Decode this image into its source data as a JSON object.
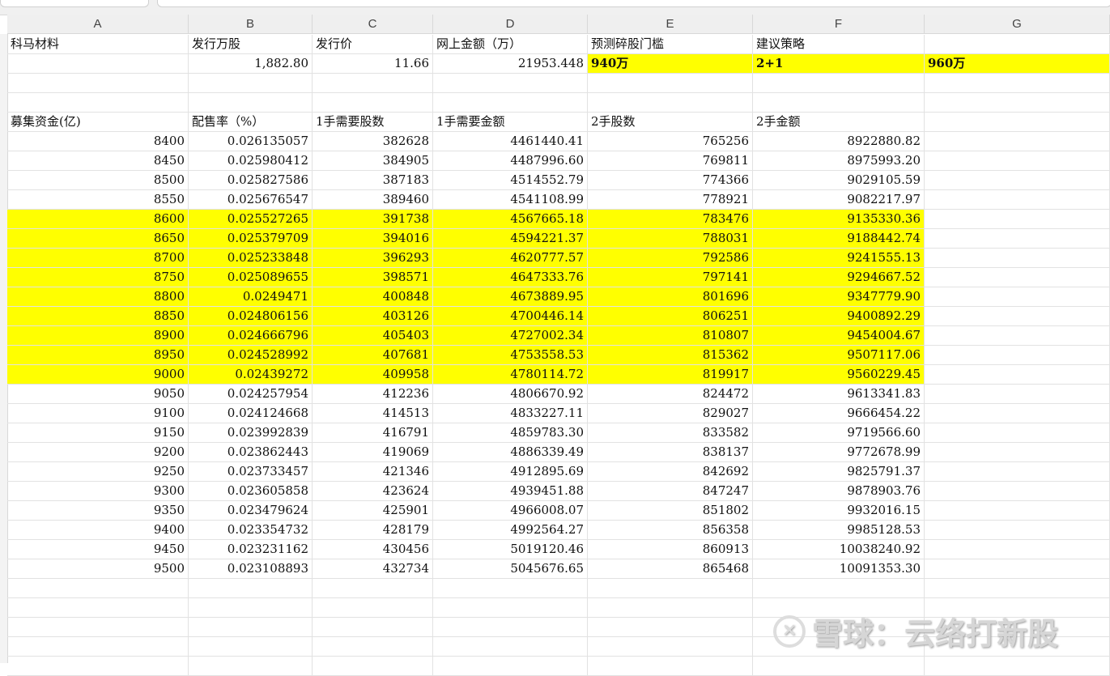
{
  "columns": [
    "A",
    "B",
    "C",
    "D",
    "E",
    "F",
    "G"
  ],
  "row1": [
    "科马材料",
    "发行万股",
    "发行价",
    "网上金额（万）",
    "预测碎股门槛",
    "建议策略",
    ""
  ],
  "row2": [
    "",
    "1,882.80",
    "11.66",
    "21953.448",
    "940万",
    "2+1",
    "960万"
  ],
  "header": [
    "募集资金(亿)",
    "配售率（%）",
    "1手需要股数",
    "1手需要金额",
    "2手股数",
    "2手金额"
  ],
  "rows": [
    [
      "8400",
      "0.026135057",
      "382628",
      "4461440.41",
      "765256",
      "8922880.82"
    ],
    [
      "8450",
      "0.025980412",
      "384905",
      "4487996.60",
      "769811",
      "8975993.20"
    ],
    [
      "8500",
      "0.025827586",
      "387183",
      "4514552.79",
      "774366",
      "9029105.59"
    ],
    [
      "8550",
      "0.025676547",
      "389460",
      "4541108.99",
      "778921",
      "9082217.97"
    ],
    [
      "8600",
      "0.025527265",
      "391738",
      "4567665.18",
      "783476",
      "9135330.36"
    ],
    [
      "8650",
      "0.025379709",
      "394016",
      "4594221.37",
      "788031",
      "9188442.74"
    ],
    [
      "8700",
      "0.025233848",
      "396293",
      "4620777.57",
      "792586",
      "9241555.13"
    ],
    [
      "8750",
      "0.025089655",
      "398571",
      "4647333.76",
      "797141",
      "9294667.52"
    ],
    [
      "8800",
      "0.0249471",
      "400848",
      "4673889.95",
      "801696",
      "9347779.90"
    ],
    [
      "8850",
      "0.024806156",
      "403126",
      "4700446.14",
      "806251",
      "9400892.29"
    ],
    [
      "8900",
      "0.024666796",
      "405403",
      "4727002.34",
      "810807",
      "9454004.67"
    ],
    [
      "8950",
      "0.024528992",
      "407681",
      "4753558.53",
      "815362",
      "9507117.06"
    ],
    [
      "9000",
      "0.02439272",
      "409958",
      "4780114.72",
      "819917",
      "9560229.45"
    ],
    [
      "9050",
      "0.024257954",
      "412236",
      "4806670.92",
      "824472",
      "9613341.83"
    ],
    [
      "9100",
      "0.024124668",
      "414513",
      "4833227.11",
      "829027",
      "9666454.22"
    ],
    [
      "9150",
      "0.023992839",
      "416791",
      "4859783.30",
      "833582",
      "9719566.60"
    ],
    [
      "9200",
      "0.023862443",
      "419069",
      "4886339.49",
      "838137",
      "9772678.99"
    ],
    [
      "9250",
      "0.023733457",
      "421346",
      "4912895.69",
      "842692",
      "9825791.37"
    ],
    [
      "9300",
      "0.023605858",
      "423624",
      "4939451.88",
      "847247",
      "9878903.76"
    ],
    [
      "9350",
      "0.023479624",
      "425901",
      "4966008.07",
      "851802",
      "9932016.15"
    ],
    [
      "9400",
      "0.023354732",
      "428179",
      "4992564.27",
      "856358",
      "9985128.53"
    ],
    [
      "9450",
      "0.023231162",
      "430456",
      "5019120.46",
      "860913",
      "10038240.92"
    ],
    [
      "9500",
      "0.023108893",
      "432734",
      "5045676.65",
      "865468",
      "10091353.30"
    ]
  ],
  "highlight_rows": [
    4,
    5,
    6,
    7,
    8,
    9,
    10,
    11,
    12
  ],
  "highlight_color": "#ffff00",
  "watermark": "雪球：云络打新股"
}
